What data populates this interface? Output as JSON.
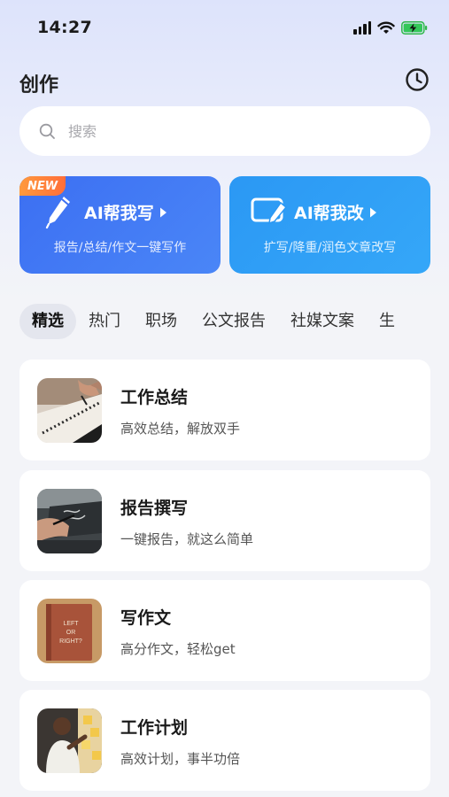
{
  "status_bar": {
    "time": "14:27",
    "icons": [
      "signal-icon",
      "wifi-icon",
      "battery-charging-icon"
    ]
  },
  "header": {
    "title": "创作",
    "history_icon": "clock-icon"
  },
  "search": {
    "placeholder": "搜索",
    "value": "",
    "icon": "search-icon"
  },
  "feature_cards": [
    {
      "badge": "NEW",
      "title": "AI帮我写",
      "subtitle": "报告/总结/作文一键写作",
      "icon": "pen-icon"
    },
    {
      "title": "AI帮我改",
      "subtitle": "扩写/降重/润色文章改写",
      "icon": "edit-doc-icon"
    }
  ],
  "tabs": [
    {
      "label": "精选",
      "active": true
    },
    {
      "label": "热门",
      "active": false
    },
    {
      "label": "职场",
      "active": false
    },
    {
      "label": "公文报告",
      "active": false
    },
    {
      "label": "社媒文案",
      "active": false
    },
    {
      "label": "生",
      "active": false
    }
  ],
  "items": [
    {
      "title": "工作总结",
      "subtitle": "高效总结，解放双手"
    },
    {
      "title": "报告撰写",
      "subtitle": "一键报告，就这么简单"
    },
    {
      "title": "写作文",
      "subtitle": "高分作文，轻松get",
      "thumb_text": "LEFT OR RIGHT?"
    },
    {
      "title": "工作计划",
      "subtitle": "高效计划，事半功倍"
    }
  ],
  "colors": {
    "write_card": "#3c6ff2",
    "edit_card": "#2b98f4",
    "new_badge": "#ff7a3a",
    "background": "#f3f4f8"
  }
}
